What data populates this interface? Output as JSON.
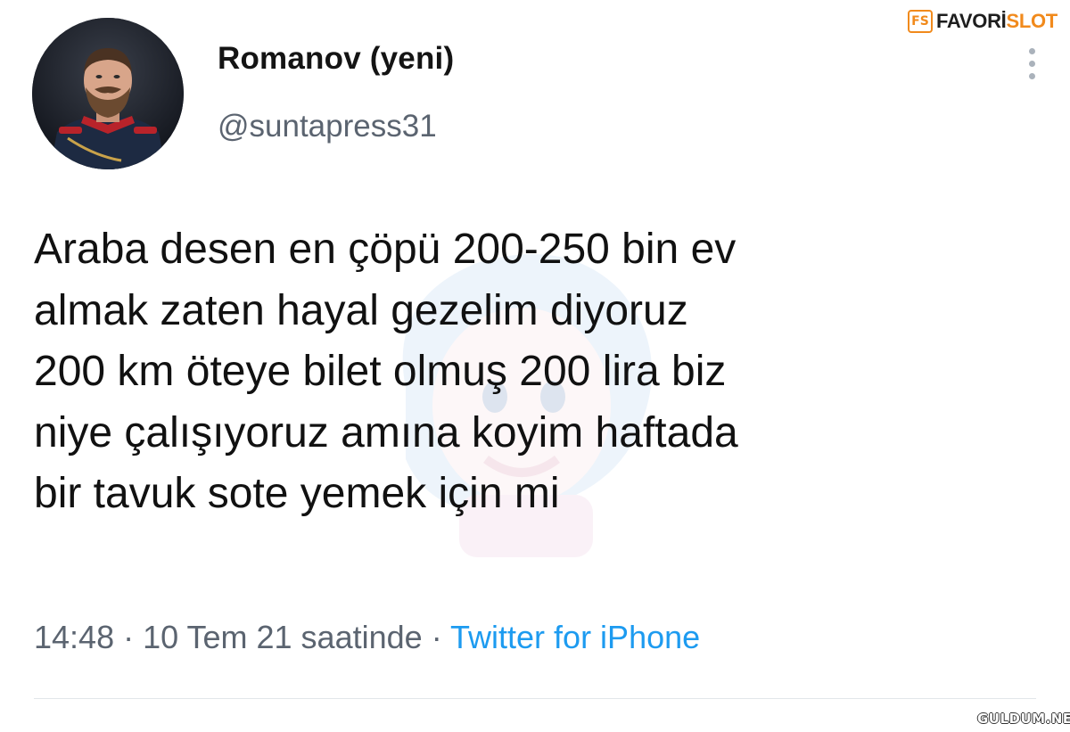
{
  "user": {
    "display_name": "Romanov (yeni)",
    "handle": "@suntapress31"
  },
  "tweet": {
    "text": "Araba desen en çöpü 200-250 bin ev\nalmak zaten hayal gezelim diyoruz\n200 km öteye bilet olmuş 200 lira biz\nniye çalışıyoruz amına koyim haftada\nbir tavuk sote yemek için mi",
    "time": "14:48",
    "date": "10 Tem 21 saatinde",
    "separator": "·",
    "source": "Twitter for iPhone"
  },
  "watermarks": {
    "brand_badge": "FS",
    "brand_part1": "FAVORİ",
    "brand_part2": "SLOT",
    "footer": "GULDUM.NET"
  },
  "icons": {
    "more": "more-vertical-icon",
    "avatar": "avatar-portrait"
  },
  "colors": {
    "text": "#111111",
    "muted": "#5b6470",
    "link": "#1d9bf0",
    "brand_orange": "#f18a1c"
  }
}
